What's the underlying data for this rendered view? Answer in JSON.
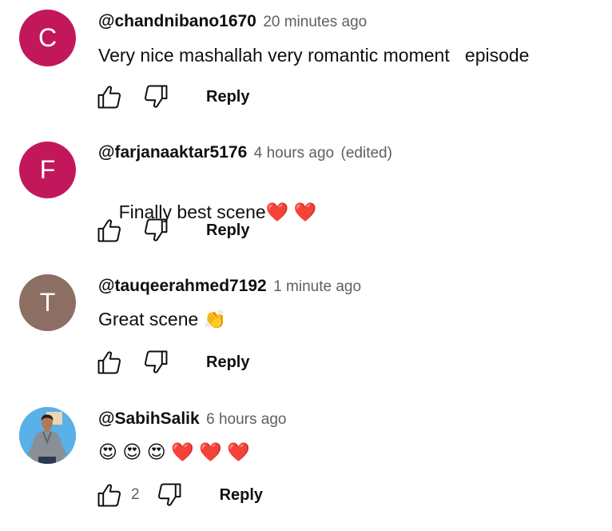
{
  "comments": [
    {
      "author": "@chandnibano1670",
      "time": "20 minutes ago",
      "edited": "",
      "text": "Very nice mashallah very romantic moment   episode",
      "avatar_letter": "C",
      "avatar_color": "#c2185b",
      "like_count": "",
      "reply_label": "Reply"
    },
    {
      "author": "@farjanaaktar5176",
      "time": "4 hours ago",
      "edited": "(edited)",
      "text": "Finally best scene❤️ ❤️",
      "avatar_letter": "F",
      "avatar_color": "#c2185b",
      "like_count": "",
      "reply_label": "Reply"
    },
    {
      "author": "@tauqeerahmed7192",
      "time": "1 minute ago",
      "edited": "",
      "text": "Great scene 👏",
      "avatar_letter": "T",
      "avatar_color": "#8d6e63",
      "like_count": "",
      "reply_label": "Reply"
    },
    {
      "author": "@SabihSalik",
      "time": "6 hours ago",
      "edited": "",
      "text": "😍 😍 😍 ❤️ ❤️ ❤️",
      "avatar_letter": "",
      "avatar_color": "#4fa3e0",
      "like_count": "2",
      "reply_label": "Reply"
    }
  ],
  "icons": {
    "like": "thumbs-up-icon",
    "dislike": "thumbs-down-icon"
  }
}
